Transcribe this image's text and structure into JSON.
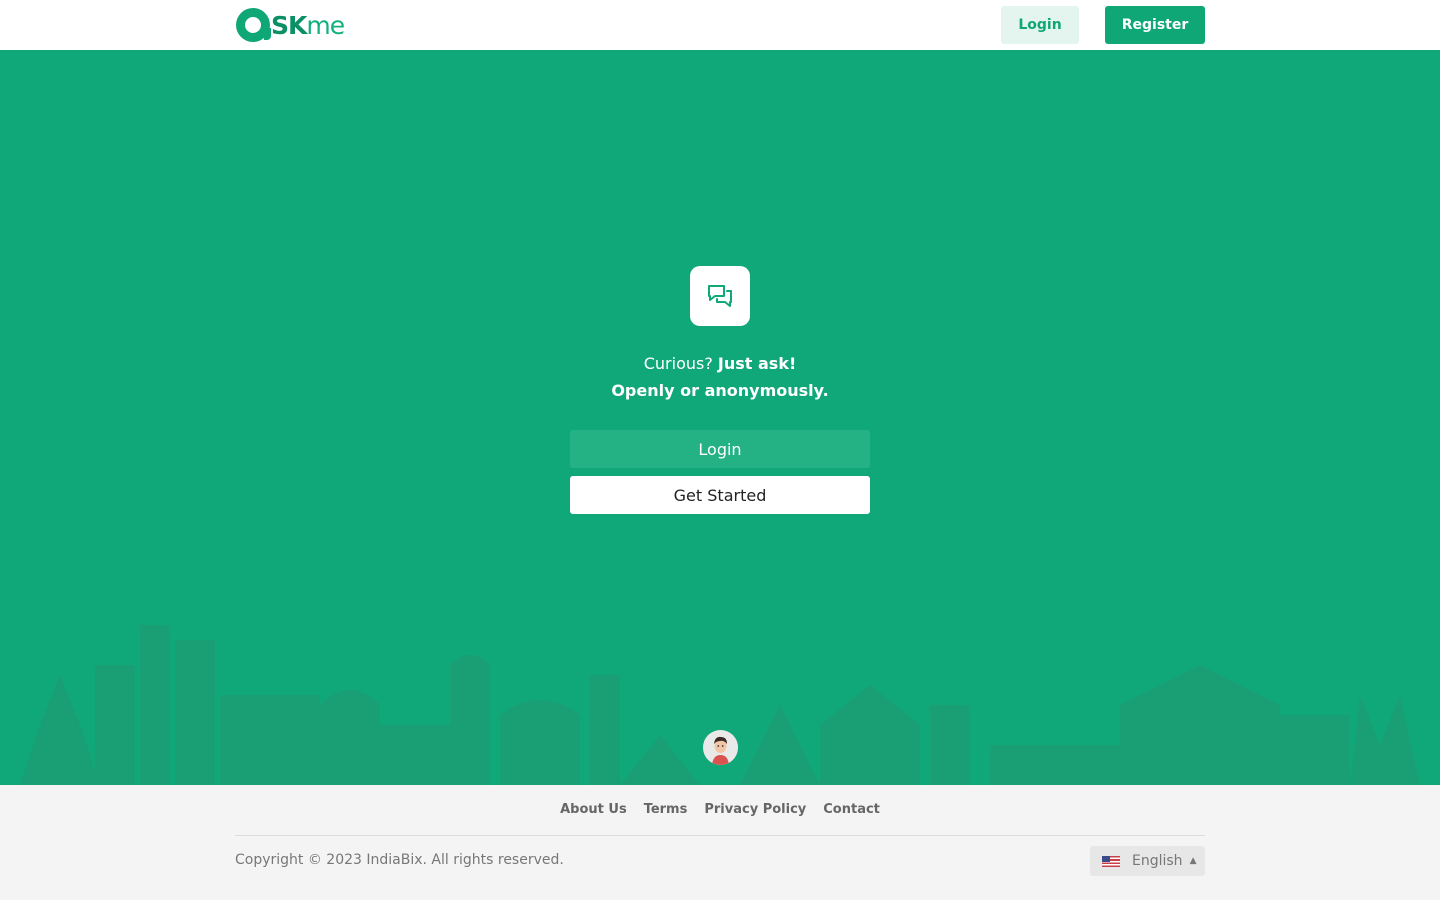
{
  "header": {
    "logo_text_a": "SK",
    "logo_text_b": "me",
    "login_label": "Login",
    "register_label": "Register"
  },
  "hero": {
    "tagline_prefix": "Curious? ",
    "tagline_strong": "Just ask!",
    "tagline_line2": "Openly or anonymously.",
    "login_label": "Login",
    "get_started_label": "Get Started",
    "icon": "chat-bubbles-icon"
  },
  "footer": {
    "links": [
      "About Us",
      "Terms",
      "Privacy Policy",
      "Contact"
    ],
    "copyright": "Copyright © 2023 IndiaBix. All rights reserved.",
    "language": "English",
    "language_flag": "us-flag-icon"
  },
  "colors": {
    "brand": "#10a878",
    "footer_bg": "#f4f4f4"
  }
}
